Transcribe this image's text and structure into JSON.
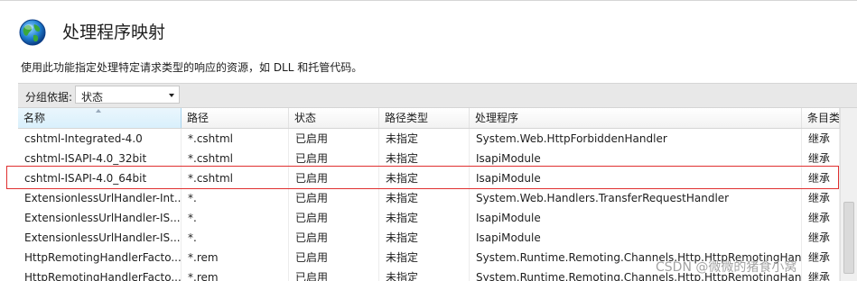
{
  "page": {
    "title": "处理程序映射",
    "description": "使用此功能指定处理特定请求类型的响应的资源，如 DLL 和托管代码。"
  },
  "toolbar": {
    "group_label": "分组依据:",
    "group_value": "状态"
  },
  "table": {
    "columns": [
      "名称",
      "路径",
      "状态",
      "路径类型",
      "处理程序",
      "条目类"
    ],
    "rows": [
      [
        "cshtml-Integrated-4.0",
        "*.cshtml",
        "已启用",
        "未指定",
        "System.Web.HttpForbiddenHandler",
        "继承"
      ],
      [
        "cshtml-ISAPI-4.0_32bit",
        "*.cshtml",
        "已启用",
        "未指定",
        "IsapiModule",
        "继承"
      ],
      [
        "cshtml-ISAPI-4.0_64bit",
        "*.cshtml",
        "已启用",
        "未指定",
        "IsapiModule",
        "继承"
      ],
      [
        "ExtensionlessUrlHandler-Int...",
        "*.",
        "已启用",
        "未指定",
        "System.Web.Handlers.TransferRequestHandler",
        "继承"
      ],
      [
        "ExtensionlessUrlHandler-IS...",
        "*.",
        "已启用",
        "未指定",
        "IsapiModule",
        "继承"
      ],
      [
        "ExtensionlessUrlHandler-IS...",
        "*.",
        "已启用",
        "未指定",
        "IsapiModule",
        "继承"
      ],
      [
        "HttpRemotingHandlerFacto...",
        "*.rem",
        "已启用",
        "未指定",
        "System.Runtime.Remoting.Channels.Http.HttpRemotingHan...",
        "继承"
      ],
      [
        "HttpRemotingHandlerFacto...",
        "*.rem",
        "已启用",
        "未指定",
        "System.Runtime.Remoting.Channels.Http.HttpRemotingHan...",
        "继承"
      ]
    ],
    "highlighted_row": 2
  },
  "watermark": "CSDN @微微的猪食小窝",
  "colors": {
    "highlight": "#e03030",
    "sorted_header": "#d9f0fc",
    "toolbar_bg": "#e8e8e8"
  },
  "icons": [
    "globe-icon",
    "sort-ascending-icon",
    "dropdown-arrow-icon"
  ]
}
